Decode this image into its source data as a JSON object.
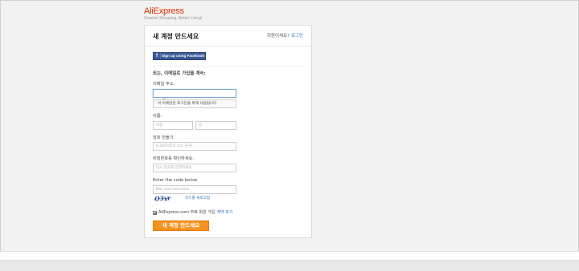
{
  "brand": {
    "ali": "Ali",
    "express": "Express",
    "tagline": "Smarter Shopping, Better Living!"
  },
  "form": {
    "title": "새 계정 만드세요",
    "member_question": "회원이세요?",
    "login_link": "로그인",
    "facebook_icon": "f",
    "facebook_label": "Sign up using Facebook",
    "or_label": "또는, 이메일로 가입을 계속:",
    "email_label": "이메일 주소:",
    "email_value": "",
    "email_tip": "이 이메일은 로그인을 위해 사용됩니다",
    "name_label": "이름:",
    "first_name_placeholder": "이름",
    "last_name_placeholder": "성",
    "password_label": "암호 만들기:",
    "password_placeholder": "6-20자(문자 또는 숫자)",
    "confirm_label": "비밀번호를 확인하세요:",
    "confirm_placeholder": "다시 암호를 입력하세요",
    "code_label": "Enter the code below",
    "code_placeholder": "Not case-sensitive",
    "captcha_text": "Q3yr",
    "refresh_link": "코드를 새로고침",
    "agree_text": "AliExpress.com 무료 회원 가입",
    "agree_link": "계약 보기",
    "agree_checked": true,
    "submit_label": "새 계정 만드세요"
  },
  "colors": {
    "brand": "#e62e04",
    "link": "#2f6bbf",
    "facebook": "#3b5998",
    "submit": "#f6921e"
  }
}
